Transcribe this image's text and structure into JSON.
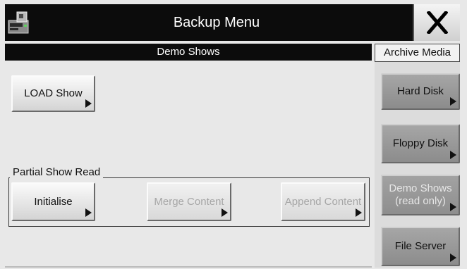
{
  "window": {
    "title": "Backup Menu",
    "app_icon": "disk-drive-icon",
    "close_icon": "close-x-icon"
  },
  "main": {
    "section_title": "Demo Shows",
    "load_button": "LOAD Show",
    "partial_group": {
      "label": "Partial Show Read",
      "buttons": {
        "initialise": "Initialise",
        "merge": "Merge Content",
        "append": "Append Content"
      }
    }
  },
  "archive": {
    "title": "Archive Media",
    "items": {
      "hard_disk": "Hard Disk",
      "floppy_disk": "Floppy Disk",
      "demo_shows_line1": "Demo Shows",
      "demo_shows_line2": "(read only)",
      "file_server": "File Server"
    }
  },
  "colors": {
    "titlebar": "#0c0c0c",
    "background": "#e8e8e8",
    "selected_archive": "#9a9a9a",
    "disabled_text": "#a6a6a6"
  }
}
